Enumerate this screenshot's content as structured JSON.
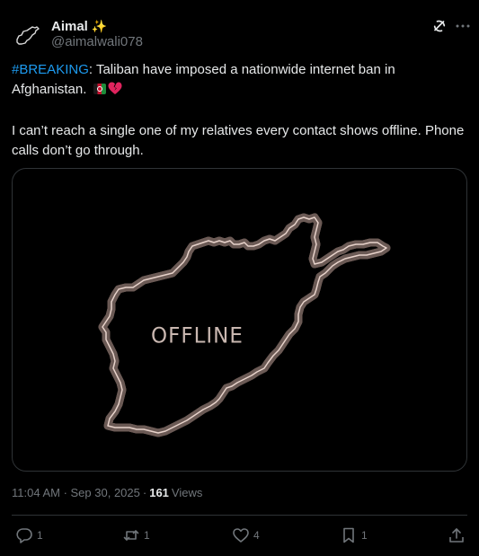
{
  "author": {
    "display_name": "Aimal",
    "badge_emoji": "✨",
    "handle": "@aimalwali078",
    "avatar_icon": "afghanistan-map-icon"
  },
  "header_icons": {
    "grok": "grok-icon",
    "more": "more-icon"
  },
  "post": {
    "hashtag": "#BREAKING",
    "line1_rest": ": Taliban have imposed a nationwide internet ban in Afghanistan.",
    "emoji_icons": [
      "afghanistan-flag-icon",
      "broken-heart-icon"
    ],
    "paragraph2": "I can’t reach a single one of my relatives every contact shows offline. Phone calls don’t go through."
  },
  "media": {
    "label": "OFFLINE",
    "map_outline_color": "#d9c2ba",
    "background": "#000000"
  },
  "meta": {
    "timestamp": "11:04 AM · Sep 30, 2025",
    "separator": "·",
    "views_count": "161",
    "views_label": "Views"
  },
  "actions": {
    "reply_count": "1",
    "repost_count": "1",
    "like_count": "4",
    "bookmark_count": "1"
  },
  "colors": {
    "text_primary": "#e7e9ea",
    "text_secondary": "#71767b",
    "link": "#1d9bf0",
    "border": "#2f3336",
    "broken_heart": "#e0245e"
  }
}
